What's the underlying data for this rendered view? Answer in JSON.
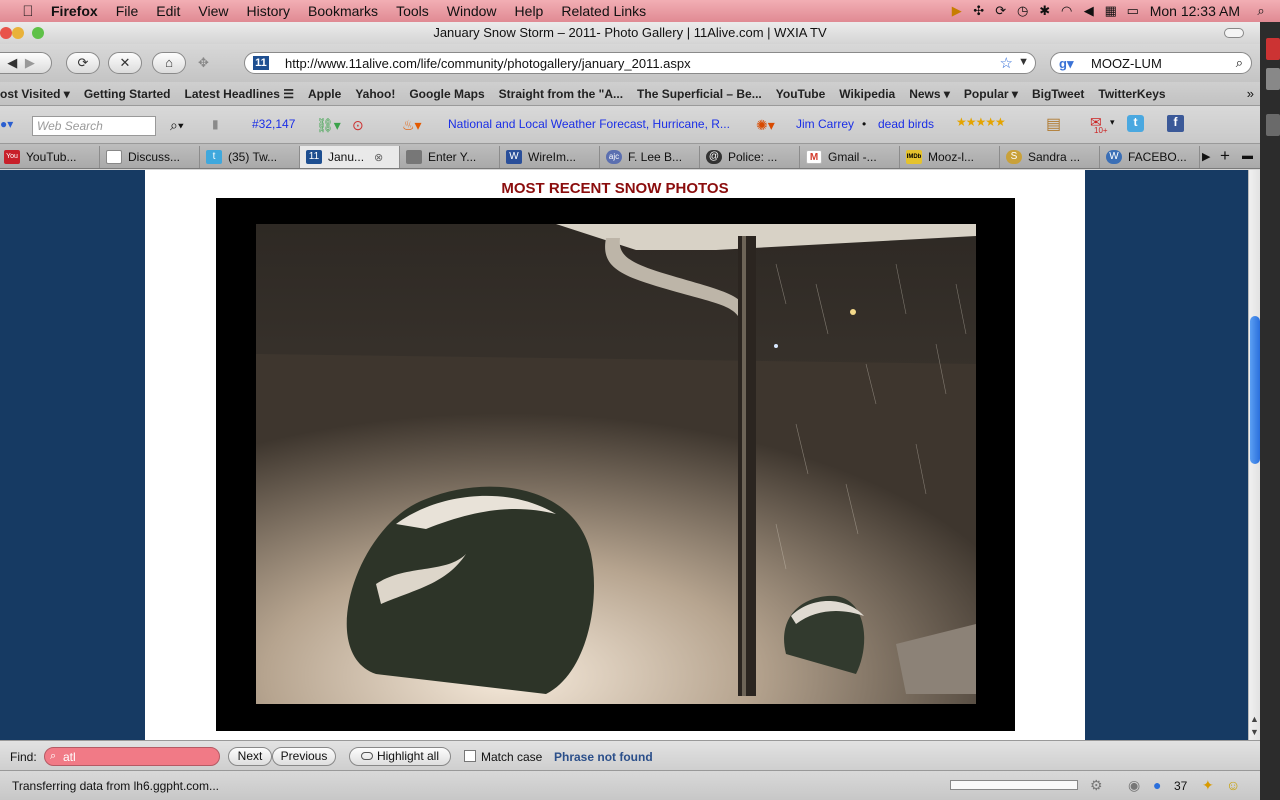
{
  "menubar": {
    "app_name": "Firefox",
    "items": [
      "File",
      "Edit",
      "View",
      "History",
      "Bookmarks",
      "Tools",
      "Window",
      "Help",
      "Related Links"
    ],
    "clock": "Mon 12:33 AM"
  },
  "window": {
    "title": "January Snow Storm – 2011- Photo Gallery | 11Alive.com | WXIA TV"
  },
  "navbar": {
    "url": "http://www.11alive.com/life/community/photogallery/january_2011.aspx",
    "search_value": "MOOZ-LUM"
  },
  "bookmarks": [
    "ost Visited ▾",
    "Getting Started",
    "Latest Headlines ☰",
    "Apple",
    "Yahoo!",
    "Google Maps",
    "Straight from the \"A...",
    "The Superficial – Be...",
    "YouTube",
    "Wikipedia",
    "News ▾",
    "Popular ▾",
    "BigTweet",
    "TwitterKeys"
  ],
  "addonbar": {
    "search_placeholder": "Web Search",
    "count": "#32,147",
    "weather_link": "National and Local Weather Forecast, Hurricane, R...",
    "link_1": "Jim Carrey",
    "separator": "•",
    "link_2": "dead birds",
    "badge": "10+"
  },
  "tabs": [
    {
      "label": "YouTub...",
      "color": "#c8202a",
      "glyph": "You"
    },
    {
      "label": "Discuss...",
      "color": "#ffffff",
      "glyph": ""
    },
    {
      "label": "(35) Tw...",
      "color": "#3fa8dd",
      "glyph": "t"
    },
    {
      "label": "Janu...",
      "color": "#1e4f91",
      "glyph": "11"
    },
    {
      "label": "Enter Y...",
      "color": "#777777",
      "glyph": ""
    },
    {
      "label": "WireIm...",
      "color": "#2a4f9a",
      "glyph": "W"
    },
    {
      "label": "F. Lee B...",
      "color": "#5b6fb0",
      "glyph": "ajc"
    },
    {
      "label": "Police: ...",
      "color": "#333333",
      "glyph": "@"
    },
    {
      "label": "Gmail -...",
      "color": "#d33b2c",
      "glyph": "M"
    },
    {
      "label": "Mooz-l...",
      "color": "#e5c32d",
      "glyph": "IMDb"
    },
    {
      "label": "Sandra ...",
      "color": "#c9a13a",
      "glyph": "S"
    },
    {
      "label": "FACEBO...",
      "color": "#3b6fb6",
      "glyph": "W"
    }
  ],
  "page": {
    "heading": "MOST RECENT SNOW PHOTOS"
  },
  "findbar": {
    "label": "Find:",
    "value": "atl",
    "next": "Next",
    "previous": "Previous",
    "highlight": "Highlight all",
    "match_case": "Match case",
    "status": "Phrase not found"
  },
  "statusbar": {
    "text": "Transferring data from lh6.ggpht.com...",
    "count": "37"
  }
}
